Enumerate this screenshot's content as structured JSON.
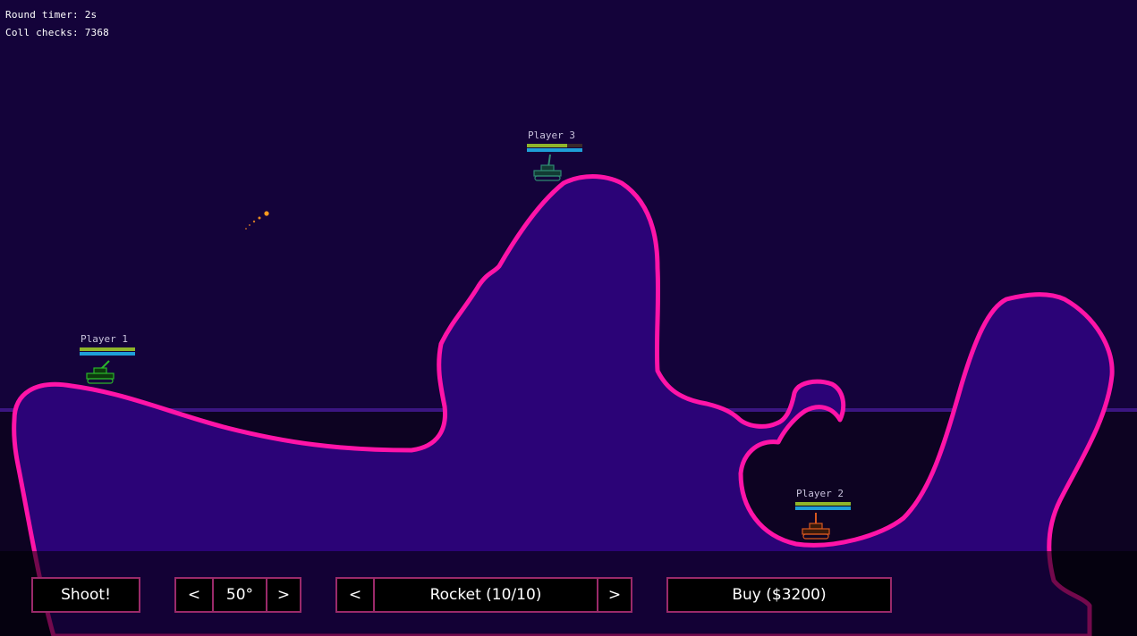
{
  "hud": {
    "round_timer": "Round timer: 2s",
    "coll_checks": "Coll checks: 7368"
  },
  "players": [
    {
      "name": "Player 1",
      "health": 1.0,
      "fuel": 1.0,
      "color": "#2bb52b"
    },
    {
      "name": "Player 3",
      "health": 0.72,
      "fuel": 1.0,
      "color": "#2f8a72"
    },
    {
      "name": "Player 2",
      "health": 1.0,
      "fuel": 1.0,
      "color": "#d8571e"
    }
  ],
  "controls": {
    "shoot_label": "Shoot!",
    "angle_prev": "<",
    "angle_value": "50°",
    "angle_next": ">",
    "weapon_prev": "<",
    "weapon_value": "Rocket (10/10)",
    "weapon_next": ">",
    "buy_label": "Buy ($3200)"
  },
  "colors": {
    "sky": "#14033a",
    "terrain_fill": "#2b0377",
    "terrain_edge": "#ff14a8",
    "water_line": "#3b1582",
    "lower_band": "#0d0322",
    "button_border": "#9a2a6a",
    "projectile": "#ff9a1e"
  }
}
